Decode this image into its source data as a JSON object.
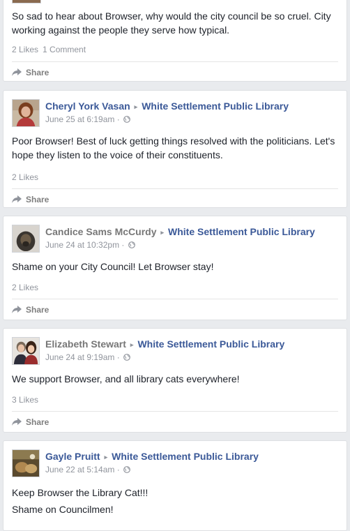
{
  "posts": [
    {
      "body": "So sad to hear about Browser, why would the city council be so cruel. City working against the people they serve how typical.",
      "likes": "2 Likes",
      "comments": "1 Comment",
      "share": "Share"
    },
    {
      "author": "Cheryl York Vasan",
      "target": "White Settlement Public Library",
      "time": "June 25 at 6:19am",
      "body": "Poor Browser! Best of luck getting things resolved with the politicians. Let's hope they listen to the voice of their constituents.",
      "likes": "2 Likes",
      "share": "Share"
    },
    {
      "author": "Candice Sams McCurdy",
      "target": "White Settlement Public Library",
      "time": "June 24 at 10:32pm",
      "body": "Shame on your City Council! Let Browser stay!",
      "likes": "2 Likes",
      "share": "Share"
    },
    {
      "author": "Elizabeth Stewart",
      "target": "White Settlement Public Library",
      "time": "June 24 at 9:19am",
      "body": "We support Browser, and all library cats everywhere!",
      "likes": "3 Likes",
      "share": "Share"
    },
    {
      "author": "Gayle Pruitt",
      "target": "White Settlement Public Library",
      "time": "June 22 at 5:14am",
      "body_lines": [
        "Keep Browser the Library Cat!!!",
        "Shame on Councilmen!"
      ]
    }
  ],
  "separator": " · ",
  "icons": {
    "share": "share-arrow-icon",
    "privacy": "globe-icon",
    "triangle": "▸"
  },
  "colors": {
    "link": "#3b5998",
    "meta": "#90949c",
    "background": "#e9ebee"
  }
}
